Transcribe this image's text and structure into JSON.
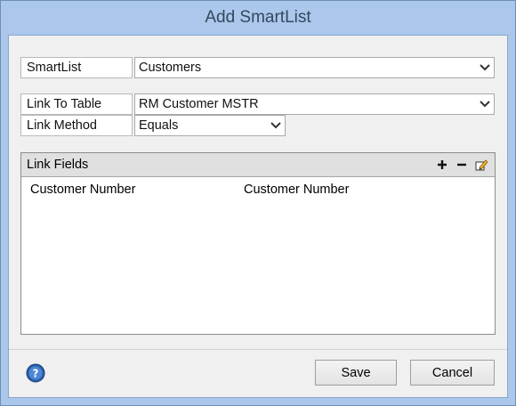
{
  "window": {
    "title": "Add SmartList"
  },
  "form": {
    "smartlist_label": "SmartList",
    "smartlist_value": "Customers",
    "link_to_table_label": "Link To Table",
    "link_to_table_value": "RM Customer MSTR",
    "link_method_label": "Link Method",
    "link_method_value": "Equals"
  },
  "link_fields": {
    "header": "Link Fields",
    "tools": {
      "add": "+",
      "remove": "−"
    },
    "rows": [
      {
        "left": "Customer Number",
        "right": "Customer Number"
      }
    ]
  },
  "buttons": {
    "save": "Save",
    "cancel": "Cancel"
  },
  "colors": {
    "title_bar": "#abc8ec",
    "help_icon": "#2a5fa8"
  }
}
